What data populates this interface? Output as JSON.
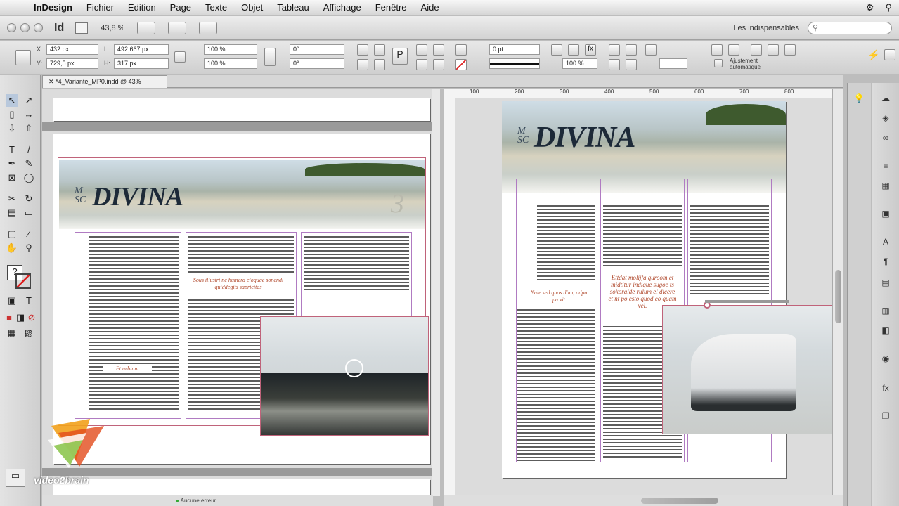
{
  "menubar": {
    "app": "InDesign",
    "items": [
      "Fichier",
      "Edition",
      "Page",
      "Texte",
      "Objet",
      "Tableau",
      "Affichage",
      "Fenêtre",
      "Aide"
    ]
  },
  "appbar": {
    "app_icon": "Id",
    "zoom": "43,8 %",
    "workspace": "Les indispensables",
    "search_placeholder": ""
  },
  "control": {
    "x_label": "X:",
    "x": "432 px",
    "y_label": "Y:",
    "y": "729,5 px",
    "l_label": "L:",
    "l": "492,667 px",
    "h_label": "H:",
    "h": "317 px",
    "scale_x": "100 %",
    "scale_y": "100 %",
    "rot": "0°",
    "shear": "0°",
    "stroke": "0 pt",
    "opacity": "100 %",
    "autofit_line1": "Ajustement",
    "autofit_line2": "automatique"
  },
  "document": {
    "tab": "*4_Variante_MP0.indd @ 43%",
    "title": "DIVINA",
    "msc": "M\nSC",
    "page_num": "3",
    "quote_left": "Sous illustri ne humerd eloquge sonendi quiddegits sapricitas",
    "quote_small": "Et urbium",
    "quote_right": "Ettdat molijfa quroom et midtitur indique sugoe ts sokoralde rulum el dicere et nt po esto quod eo quam vel.",
    "quote_right2": "Nale sed quos dbm, adpa pa vit"
  },
  "rulers": [
    "100",
    "200",
    "300",
    "400",
    "500",
    "600",
    "700",
    "800"
  ],
  "status": {
    "left": "Aucune erreur",
    "right": ""
  },
  "watermark": "video2brain"
}
